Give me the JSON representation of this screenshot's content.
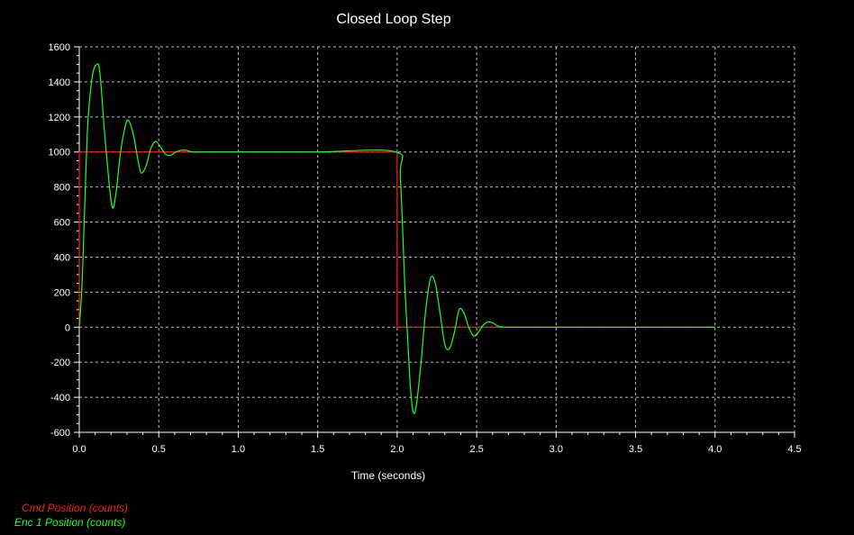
{
  "chart_data": {
    "type": "line",
    "title": "Closed Loop Step",
    "xlabel": "Time (seconds)",
    "ylabel": "",
    "xlim": [
      0,
      4.5
    ],
    "ylim": [
      -600,
      1600
    ],
    "x_ticks": [
      "0.0",
      "0.5",
      "1.0",
      "1.5",
      "2.0",
      "2.5",
      "3.0",
      "3.5",
      "4.0",
      "4.5"
    ],
    "y_ticks": [
      "1600",
      "1400",
      "1200",
      "1000",
      "800",
      "600",
      "400",
      "200",
      "0",
      "-200",
      "-400",
      "-600"
    ],
    "grid": true,
    "background": "#000000",
    "series": [
      {
        "name": "Cmd Position (counts)",
        "color": "#ff1a1a",
        "x": [
          0.0,
          0.0,
          2.0,
          2.0,
          4.0
        ],
        "y": [
          0,
          1000,
          1000,
          0,
          0
        ]
      },
      {
        "name": "Enc 1 Position (counts)",
        "color": "#22ff22",
        "x": [
          0.0,
          0.02,
          0.05,
          0.08,
          0.11,
          0.13,
          0.16,
          0.19,
          0.21,
          0.23,
          0.26,
          0.29,
          0.31,
          0.34,
          0.37,
          0.39,
          0.42,
          0.45,
          0.48,
          0.51,
          0.54,
          0.57,
          0.61,
          0.64,
          0.67,
          0.71,
          0.75,
          1.0,
          1.5,
          1.99,
          2.02,
          2.05,
          2.08,
          2.1,
          2.12,
          2.15,
          2.18,
          2.21,
          2.24,
          2.27,
          2.3,
          2.33,
          2.36,
          2.39,
          2.42,
          2.45,
          2.48,
          2.51,
          2.54,
          2.57,
          2.6,
          2.64,
          2.7,
          3.0,
          3.5,
          4.0
        ],
        "y": [
          0,
          300,
          1100,
          1420,
          1500,
          1450,
          1100,
          800,
          680,
          760,
          1000,
          1150,
          1180,
          1100,
          950,
          880,
          920,
          1020,
          1060,
          1030,
          990,
          980,
          1000,
          1010,
          1010,
          1000,
          1000,
          1000,
          1000,
          1000,
          850,
          200,
          -300,
          -480,
          -450,
          -200,
          100,
          280,
          250,
          80,
          -100,
          -120,
          -30,
          100,
          80,
          0,
          -50,
          -30,
          10,
          30,
          25,
          5,
          0,
          0,
          0,
          0
        ]
      }
    ]
  }
}
